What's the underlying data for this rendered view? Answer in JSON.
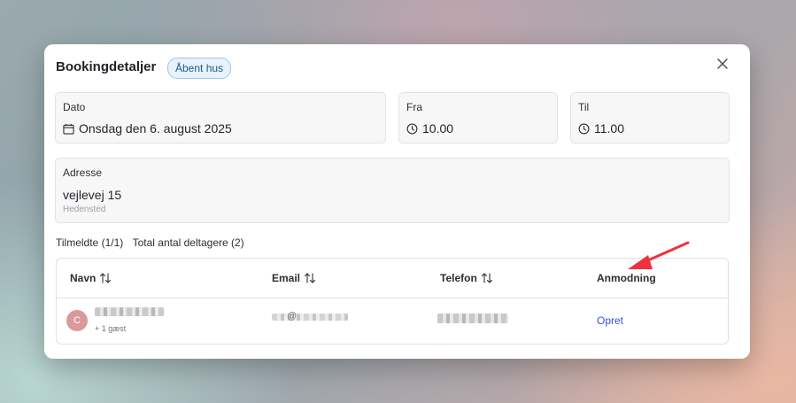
{
  "modal": {
    "title": "Bookingdetaljer",
    "badge": "Åbent hus",
    "close_icon": "close-icon"
  },
  "fields": {
    "date": {
      "label": "Dato",
      "value": "Onsdag den 6. august 2025",
      "icon": "calendar-icon"
    },
    "from": {
      "label": "Fra",
      "value": "10.00",
      "icon": "clock-icon"
    },
    "to": {
      "label": "Til",
      "value": "11.00",
      "icon": "clock-icon"
    },
    "address": {
      "label": "Adresse",
      "street": "vejlevej 15",
      "city": "Hedensted"
    }
  },
  "summary": {
    "registered": "Tilmeldte (1/1)",
    "total": "Total antal deltagere (2)"
  },
  "table": {
    "columns": [
      {
        "label": "Navn",
        "sortable": true
      },
      {
        "label": "Email",
        "sortable": true
      },
      {
        "label": "Telefon",
        "sortable": true
      },
      {
        "label": "Anmodning",
        "sortable": false
      }
    ],
    "rows": [
      {
        "avatar_initial": "C",
        "guest_note": "+ 1 gæst",
        "email_visible": "@",
        "request_link": "Opret"
      }
    ]
  },
  "colors": {
    "badge_border": "#9cc8e6",
    "link": "#3b4fd8",
    "annotation_arrow": "#f0323c",
    "avatar": "#d99a9a"
  }
}
